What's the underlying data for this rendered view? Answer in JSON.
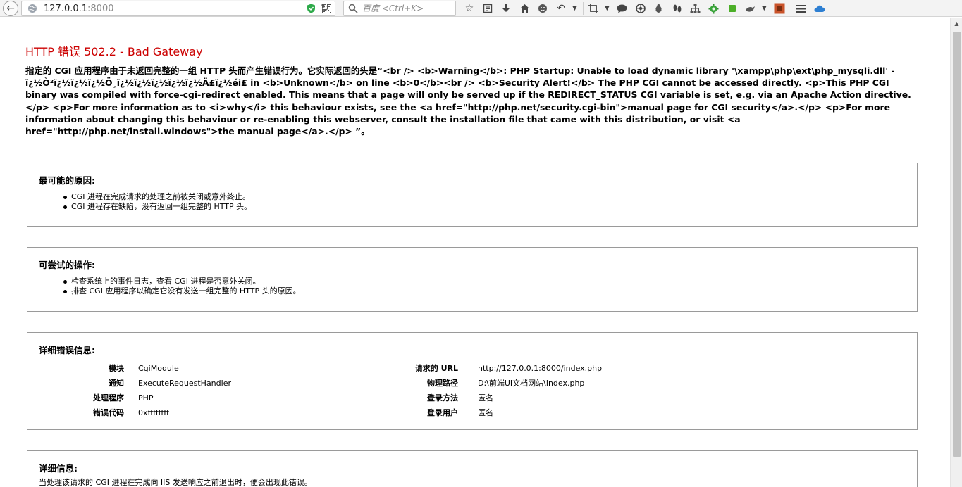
{
  "browser": {
    "url_host": "127.0.0.1",
    "url_port": ":8000",
    "search_placeholder": "百度 <Ctrl+K>"
  },
  "page": {
    "title": "HTTP 错误 502.2 - Bad Gateway",
    "description": "指定的 CGI 应用程序由于未返回完整的一组 HTTP 头而产生错误行为。它实际返回的头是“<br /> <b>Warning</b>: PHP Startup: Unable to load dynamic library '\\xampp\\php\\ext\\php_mysqli.dll' - ï¿½Ò²ï¿½ï¿½ï¿½Ö¸ï¿½ï¿½ï¿½ï¿½ï¿½Ä£ï¿½éi£ in <b>Unknown</b> on line <b>0</b><br /> <b>Security Alert!</b> The PHP CGI cannot be accessed directly. <p>This PHP CGI binary was compiled with force-cgi-redirect enabled. This means that a page will only be served up if the REDIRECT_STATUS CGI variable is set, e.g. via an Apache Action directive.</p> <p>For more information as to <i>why</i> this behaviour exists, see the <a href=\"http://php.net/security.cgi-bin\">manual page for CGI security</a>.</p> <p>For more information about changing this behaviour or re-enabling this webserver, consult the installation file that came with this distribution, or visit <a href=\"http://php.net/install.windows\">the manual page</a>.</p> ”。",
    "causes": {
      "heading": "最可能的原因:",
      "items": [
        "CGI 进程在完成请求的处理之前被关闭或意外终止。",
        "CGI 进程存在缺陷，没有返回一组完整的 HTTP 头。"
      ]
    },
    "actions": {
      "heading": "可尝试的操作:",
      "items": [
        "检查系统上的事件日志，查看 CGI 进程是否意外关闭。",
        "排查 CGI 应用程序以确定它没有发送一组完整的 HTTP 头的原因。"
      ]
    },
    "details": {
      "heading": "详细错误信息:",
      "left": [
        {
          "label": "模块",
          "value": "CgiModule"
        },
        {
          "label": "通知",
          "value": "ExecuteRequestHandler"
        },
        {
          "label": "处理程序",
          "value": "PHP"
        },
        {
          "label": "错误代码",
          "value": "0xffffffff"
        }
      ],
      "right": [
        {
          "label": "请求的 URL",
          "value": "http://127.0.0.1:8000/index.php"
        },
        {
          "label": "物理路径",
          "value": "D:\\前端UI文档网站\\index.php"
        },
        {
          "label": "登录方法",
          "value": "匿名"
        },
        {
          "label": "登录用户",
          "value": "匿名"
        }
      ]
    },
    "info": {
      "heading": "详细信息:",
      "text": "当处理该请求的 CGI 进程在完成向 IIS 发送响应之前退出时，便会出现此错误。"
    }
  },
  "colors": {
    "title_red": "#cc0000",
    "box_border": "#9a9a9a",
    "shield_green": "#2eaa4a"
  }
}
